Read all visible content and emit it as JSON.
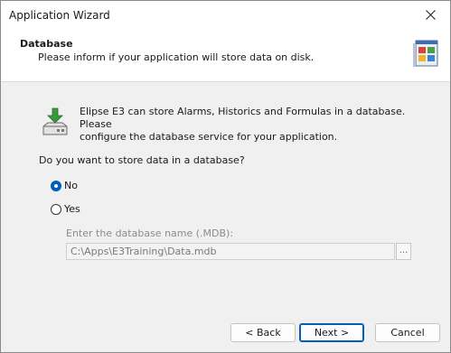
{
  "window": {
    "title": "Application Wizard"
  },
  "header": {
    "title": "Database",
    "subtitle": "Please inform if your application will store data on disk."
  },
  "info": {
    "line1": "Elipse E3 can store Alarms, Historics and Formulas in a database. Please",
    "line2": "configure the database service for your application."
  },
  "question": "Do you want to store data in a database?",
  "options": [
    {
      "label": "No",
      "selected": true
    },
    {
      "label": "Yes",
      "selected": false
    }
  ],
  "database": {
    "label": "Enter the database name (.MDB):",
    "value": "C:\\Apps\\E3Training\\Data.mdb",
    "browse_label": "..."
  },
  "buttons": {
    "back": "< Back",
    "next": "Next >",
    "cancel": "Cancel"
  },
  "colors": {
    "accent": "#005fb8",
    "disabled_text": "#8c8c8c"
  }
}
